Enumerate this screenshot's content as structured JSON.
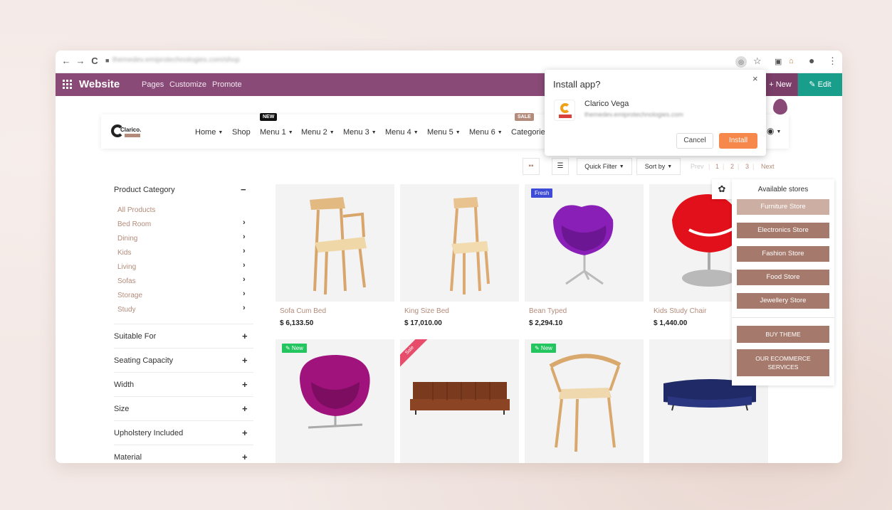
{
  "browser": {
    "url": "themedev.emiprotechnologies.com/shop",
    "back": "←",
    "forward": "→",
    "reload": "C",
    "lock": "🔒",
    "icons": [
      "target-icon",
      "star-icon",
      "extension-icon",
      "shop-icon",
      "profile-icon",
      "menu-icon"
    ]
  },
  "odoo": {
    "title": "Website",
    "links": [
      "Pages",
      "Customize",
      "Promote"
    ],
    "new_label": "+ New",
    "edit_label": "✎ Edit",
    "bar_color": "#8a4a78",
    "edit_color": "#1a9e8c"
  },
  "site": {
    "logo_text": "Clarico.",
    "menu": [
      "Home",
      "Shop",
      "Menu 1",
      "Menu 2",
      "Menu 3",
      "Menu 4",
      "Menu 5",
      "Menu 6",
      "Categories"
    ],
    "new_tag": "NEW",
    "sale_tag": "SALE",
    "accent": "#b38b7a"
  },
  "install_popup": {
    "title": "Install app?",
    "app_name": "Clarico Vega",
    "app_url": "themedev.emiprotechnologies.com",
    "cancel": "Cancel",
    "install": "Install",
    "close": "×"
  },
  "toolbar": {
    "quick_filter": "Quick Filter",
    "sort_by": "Sort by",
    "pager": [
      "Prev",
      "1",
      "2",
      "3",
      "Next"
    ]
  },
  "sidebar": {
    "category_title": "Product Category",
    "categories": [
      {
        "label": "All Products",
        "has_children": false
      },
      {
        "label": "Bed Room",
        "has_children": true
      },
      {
        "label": "Dining",
        "has_children": true
      },
      {
        "label": "Kids",
        "has_children": true
      },
      {
        "label": "Living",
        "has_children": true
      },
      {
        "label": "Sofas",
        "has_children": true
      },
      {
        "label": "Storage",
        "has_children": true
      },
      {
        "label": "Study",
        "has_children": true
      }
    ],
    "filters": [
      "Suitable For",
      "Seating Capacity",
      "Width",
      "Size",
      "Upholstery Included",
      "Material"
    ]
  },
  "products": [
    {
      "name": "Sofa Cum Bed",
      "price": "$ 6,133.50",
      "badge": ""
    },
    {
      "name": "King Size Bed",
      "price": "$ 17,010.00",
      "badge": ""
    },
    {
      "name": "Bean Typed",
      "price": "$ 2,294.10",
      "badge": "Fresh"
    },
    {
      "name": "Kids Study Chair",
      "price": "$ 1,440.00",
      "badge": ""
    },
    {
      "name": "",
      "price": "",
      "badge": "✎ New"
    },
    {
      "name": "",
      "price": "",
      "badge": "Sale"
    },
    {
      "name": "",
      "price": "",
      "badge": "✎ New"
    },
    {
      "name": "",
      "price": "",
      "badge": ""
    }
  ],
  "stores": {
    "title": "Available stores",
    "items": [
      "Furniture Store",
      "Electronics Store",
      "Fashion Store",
      "Food Store",
      "Jewellery Store"
    ],
    "buy_theme": "BUY THEME",
    "services": [
      "OUR ECOMMERCE",
      "SERVICES"
    ]
  }
}
